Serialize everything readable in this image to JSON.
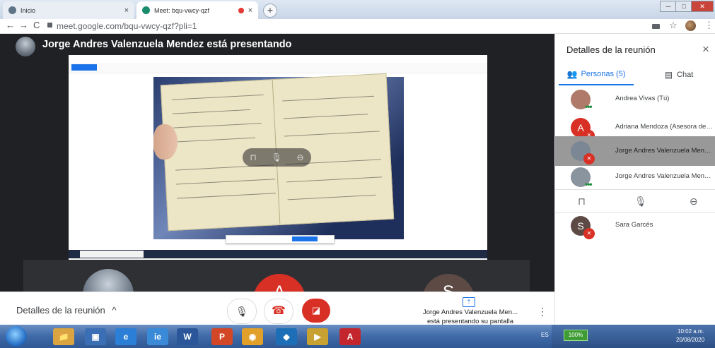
{
  "browser": {
    "tabs": [
      {
        "title": "Inicio",
        "close": "×"
      },
      {
        "title": "Meet: bqu-vwcy-qzf",
        "close": "×"
      }
    ],
    "new_tab": "+",
    "window_controls": {
      "min": "─",
      "max": "□",
      "close": "✕"
    },
    "nav": {
      "back": "←",
      "forward": "→",
      "reload": "C"
    },
    "url": "meet.google.com/bqu-vwcy-qzf?pli=1",
    "star": "☆",
    "menu": "⋮"
  },
  "meet": {
    "presenter_title": "Jorge Andres Valenzuela Mendez está presentando",
    "overlay_controls": {
      "pin": "⊓",
      "mute": "🎙",
      "remove": "⊖"
    },
    "tile_initials": [
      "A",
      "S"
    ],
    "bottom": {
      "details_label": "Detalles de la reunión",
      "details_chevron": "^",
      "mic_icon": "🎙",
      "hangup_icon": "☎",
      "cam_icon": "◪",
      "present_icon": "⇡",
      "present_name": "Jorge Andres Valenzuela Men...",
      "present_sub": "está presentando su pantalla",
      "kebab": "⋮"
    }
  },
  "panel": {
    "title": "Detalles de la reunión",
    "close": "×",
    "tab_people": "Personas (5)",
    "tab_chat": "Chat",
    "people_icon": "👥",
    "chat_icon": "▤",
    "participants": [
      {
        "name": "Andrea Vivas (Tú)",
        "initial": "",
        "avatar_color": "#b07a6a",
        "status": "speaking"
      },
      {
        "name": "Adriana Mendoza (Asesora de ...",
        "initial": "A",
        "avatar_color": "#d93025",
        "status": "muted"
      },
      {
        "name": "Jorge Andres Valenzuela Mend...",
        "initial": "",
        "avatar_color": "#7b8794",
        "status": "muted"
      },
      {
        "name": "Jorge Andres Valenzuela Mend...",
        "initial": "",
        "avatar_color": "#8a949f",
        "status": "speaking"
      },
      {
        "name": "Sara Garcés",
        "initial": "S",
        "avatar_color": "#5d4a45",
        "status": "muted"
      }
    ],
    "row_controls": {
      "pin": "⊓",
      "mic": "🎙",
      "remove": "⊖"
    }
  },
  "taskbar": {
    "language": "ES",
    "battery": "100%",
    "time": "10:02 a.m.",
    "date": "20/08/2020",
    "apps": [
      {
        "name": "explorer",
        "label": "📁",
        "color": "#d9a441"
      },
      {
        "name": "media",
        "label": "▣",
        "color": "#3b6fb5"
      },
      {
        "name": "internet-explorer",
        "label": "e",
        "color": "#2c7fd6"
      },
      {
        "name": "ie-alt",
        "label": "ie",
        "color": "#3a8ad8"
      },
      {
        "name": "word",
        "label": "W",
        "color": "#2b579a"
      },
      {
        "name": "powerpoint",
        "label": "P",
        "color": "#d24726"
      },
      {
        "name": "chrome",
        "label": "◉",
        "color": "#e0a02a"
      },
      {
        "name": "app-diamond",
        "label": "◆",
        "color": "#1c6fb7"
      },
      {
        "name": "winamp",
        "label": "▶",
        "color": "#c7a233"
      },
      {
        "name": "acrobat",
        "label": "A",
        "color": "#c4262e"
      }
    ]
  },
  "colors": {
    "stage": "#202124",
    "accent": "#1a73e8",
    "danger": "#d93025"
  }
}
